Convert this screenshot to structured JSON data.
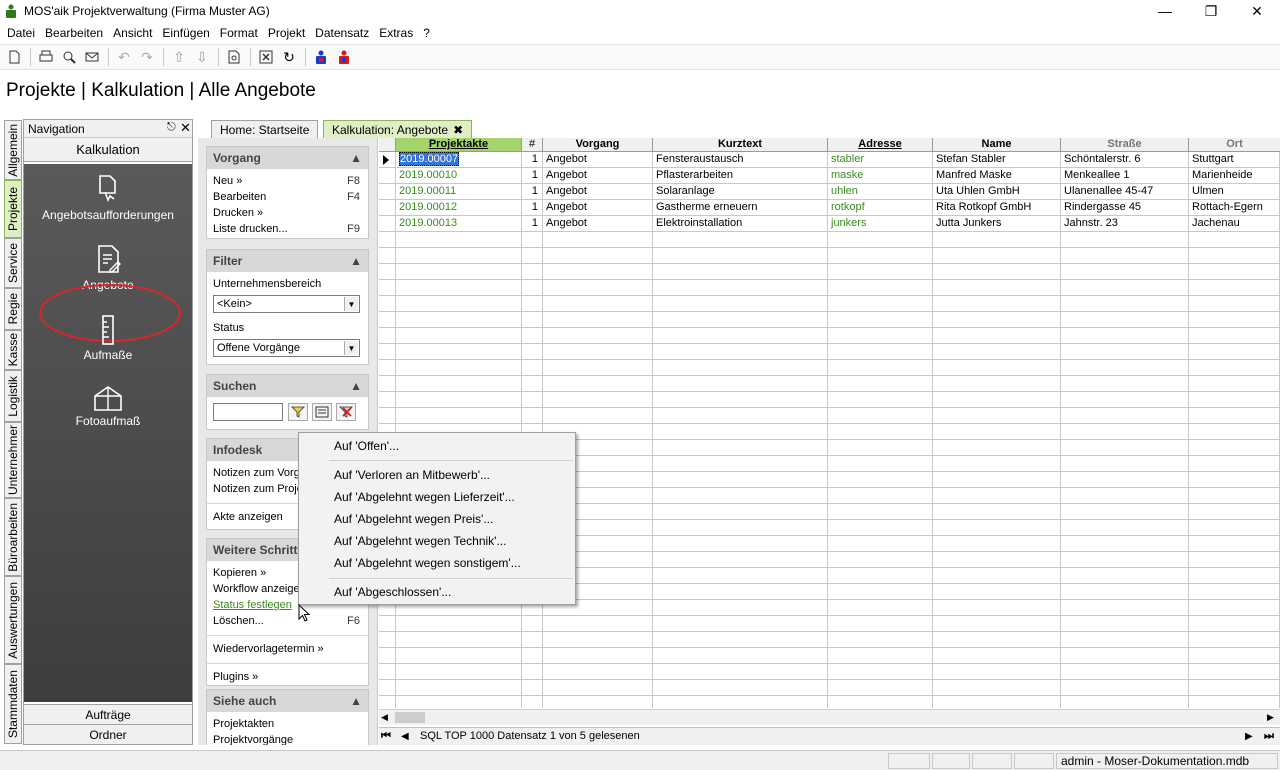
{
  "window": {
    "title": "MOS'aik Projektverwaltung (Firma Muster AG)"
  },
  "menu": [
    {
      "label": "Datei"
    },
    {
      "label": "Bearbeiten"
    },
    {
      "label": "Ansicht"
    },
    {
      "label": "Einfügen"
    },
    {
      "label": "Format"
    },
    {
      "label": "Projekt"
    },
    {
      "label": "Datensatz"
    },
    {
      "label": "Extras"
    },
    {
      "label": "?"
    }
  ],
  "header": {
    "title": "Projekte | Kalkulation | Alle Angebote"
  },
  "vtabs": [
    {
      "label": "Allgemein"
    },
    {
      "label": "Projekte"
    },
    {
      "label": "Service"
    },
    {
      "label": "Regie"
    },
    {
      "label": "Kasse"
    },
    {
      "label": "Logistik"
    },
    {
      "label": "Unternehmer"
    },
    {
      "label": "Büroarbeiten"
    },
    {
      "label": "Auswertungen"
    },
    {
      "label": "Stammdaten"
    }
  ],
  "nav": {
    "title": "Navigation",
    "pin": "↑",
    "section": "Kalkulation",
    "items": [
      {
        "label": "Angebotsaufforderungen"
      },
      {
        "label": "Angebote"
      },
      {
        "label": "Aufmaße"
      },
      {
        "label": "Fotoaufmaß"
      }
    ],
    "bottom": [
      {
        "label": "Aufträge"
      },
      {
        "label": "Ordner"
      }
    ]
  },
  "doctabs": [
    {
      "label": "Home: Startseite"
    },
    {
      "label": "Kalkulation: Angebote"
    }
  ],
  "taskpane": {
    "vorgang": {
      "title": "Vorgang",
      "items": [
        {
          "label": "Neu »",
          "key": "F8"
        },
        {
          "label": "Bearbeiten",
          "key": "F4"
        },
        {
          "label": "Drucken »",
          "key": ""
        },
        {
          "label": "Liste drucken...",
          "key": "F9"
        }
      ]
    },
    "filter": {
      "title": "Filter",
      "unternehmensbereich_label": "Unternehmensbereich",
      "unternehmensbereich_value": "<Kein>",
      "status_label": "Status",
      "status_value": "Offene Vorgänge"
    },
    "suchen": {
      "title": "Suchen",
      "value": ""
    },
    "infodesk": {
      "title": "Infodesk",
      "items": [
        {
          "label": "Notizen zum Vorga"
        },
        {
          "label": "Notizen zum Proje"
        },
        {
          "label": "Akte anzeigen"
        }
      ]
    },
    "weitere": {
      "title": "Weitere Schritt",
      "items": [
        {
          "label": "Kopieren »",
          "key": ""
        },
        {
          "label": "Workflow anzeige",
          "key": ""
        },
        {
          "label": "Status festlegen",
          "key": ""
        },
        {
          "label": "Löschen...",
          "key": "F6"
        },
        {
          "label": "Wiedervorlagetermin »",
          "key": ""
        },
        {
          "label": "Plugins »",
          "key": ""
        }
      ]
    },
    "siehe": {
      "title": "Siehe auch",
      "items": [
        {
          "label": "Projektakten"
        },
        {
          "label": "Projektvorgänge"
        }
      ]
    }
  },
  "grid": {
    "columns": [
      "Projektakte",
      "#",
      "Vorgang",
      "Kurztext",
      "Adresse",
      "Name",
      "Straße",
      "Ort"
    ],
    "rows": [
      [
        "2019.00007",
        "1",
        "Angebot",
        "Fensteraustausch",
        "stabler",
        "Stefan Stabler",
        "Schöntalerstr. 6",
        "Stuttgart"
      ],
      [
        "2019.00010",
        "1",
        "Angebot",
        "Pflasterarbeiten",
        "maske",
        "Manfred Maske",
        "Menkeallee 1",
        "Marienheide"
      ],
      [
        "2019.00011",
        "1",
        "Angebot",
        "Solaranlage",
        "uhlen",
        "Uta Uhlen GmbH",
        "Ulanenallee 45-47",
        "Ulmen"
      ],
      [
        "2019.00012",
        "1",
        "Angebot",
        "Gastherme erneuern",
        "rotkopf",
        "Rita Rotkopf GmbH",
        "Rindergasse 45",
        "Rottach-Egern"
      ],
      [
        "2019.00013",
        "1",
        "Angebot",
        "Elektroinstallation",
        "junkers",
        "Jutta Junkers",
        "Jahnstr. 23",
        "Jachenau"
      ]
    ],
    "status": "SQL TOP 1000 Datensatz 1 von 5 gelesenen"
  },
  "context_menu": {
    "items": [
      {
        "label": "Auf 'Offen'..."
      },
      {
        "label": "Auf 'Verloren an Mitbewerb'..."
      },
      {
        "label": "Auf 'Abgelehnt wegen Lieferzeit'..."
      },
      {
        "label": "Auf 'Abgelehnt wegen Preis'..."
      },
      {
        "label": "Auf 'Abgelehnt wegen Technik'..."
      },
      {
        "label": "Auf 'Abgelehnt wegen sonstigem'..."
      },
      {
        "label": "Auf 'Abgeschlossen'..."
      }
    ]
  },
  "statusbar": {
    "text": "admin - Moser-Dokumentation.mdb"
  },
  "colors": {
    "accent_green": "#3c8c1e",
    "active_tab": "#dfeec4",
    "highlight_red": "#e0222c",
    "selection": "#3375d6"
  }
}
